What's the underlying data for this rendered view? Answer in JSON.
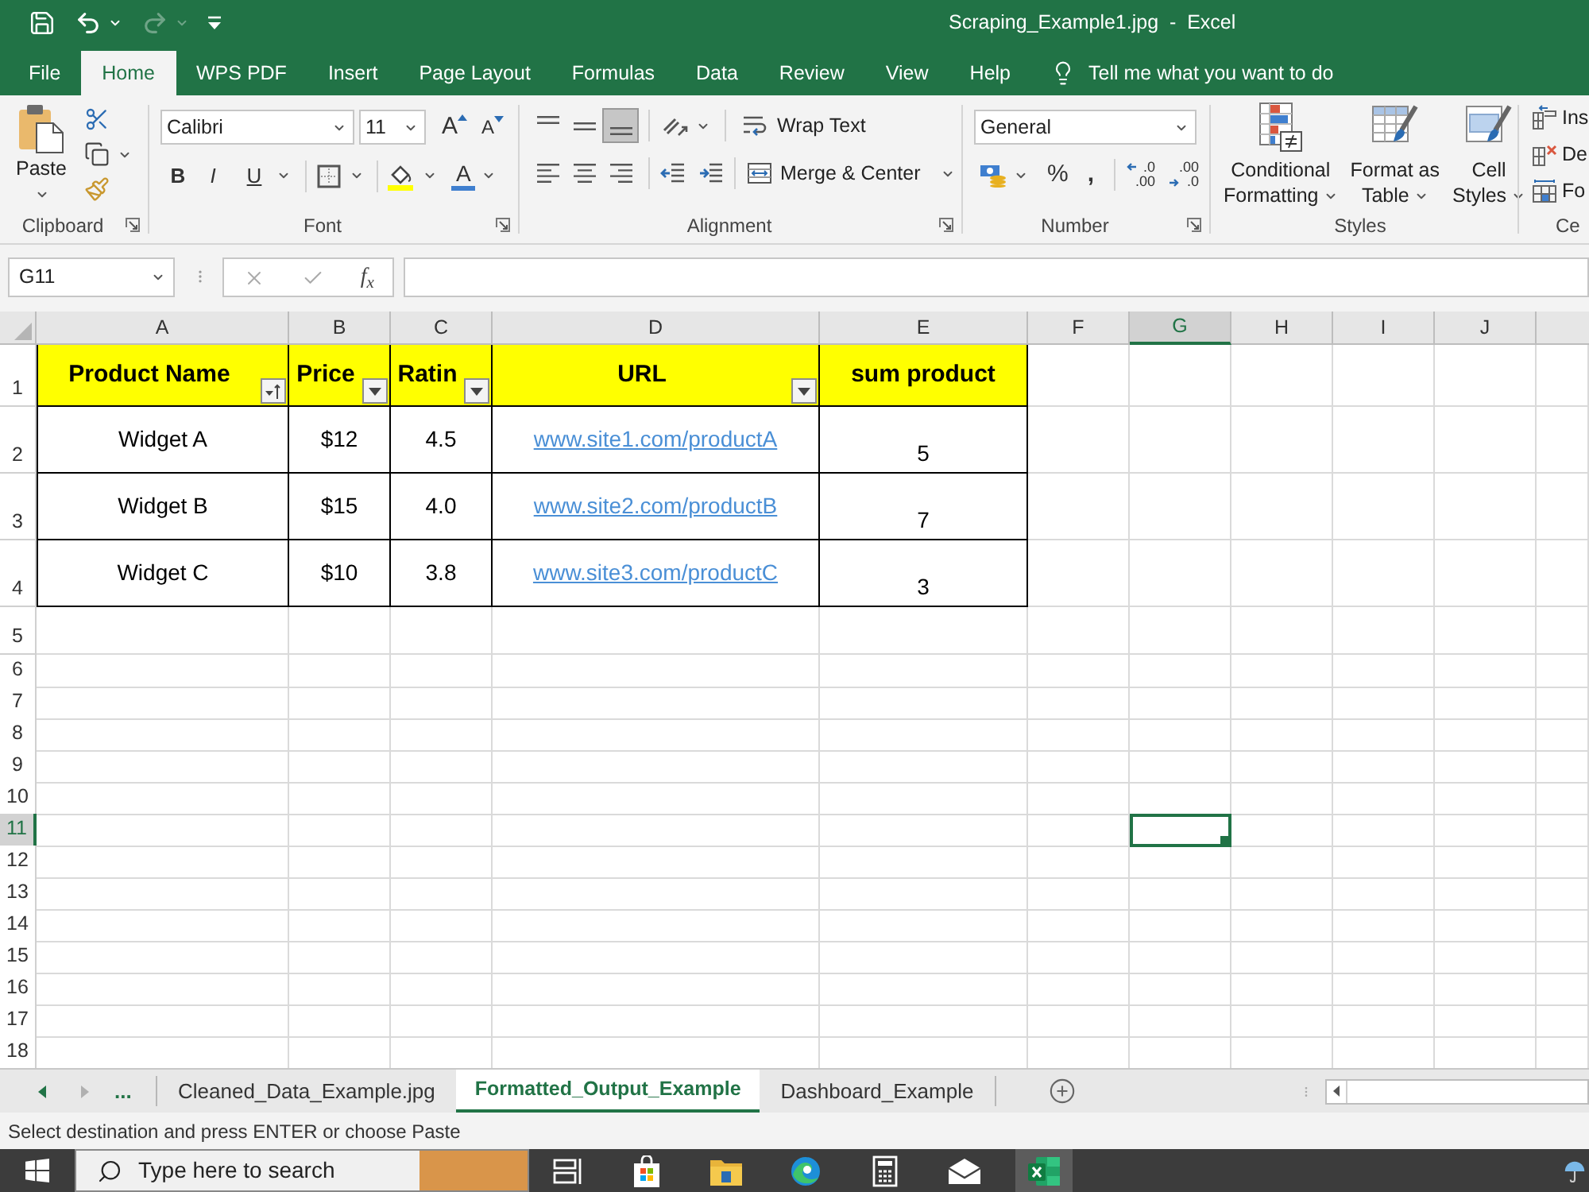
{
  "window": {
    "title": "Scraping_Example1.jpg  -  Excel"
  },
  "quick_access": [
    {
      "kind": "save",
      "disabled": false
    },
    {
      "kind": "undo",
      "disabled": false
    },
    {
      "kind": "redo",
      "disabled": true
    },
    {
      "kind": "customize",
      "disabled": false
    }
  ],
  "ribbon_tabs": [
    {
      "label": "File",
      "selected": false
    },
    {
      "label": "Home",
      "selected": true
    },
    {
      "label": "WPS PDF",
      "selected": false
    },
    {
      "label": "Insert",
      "selected": false
    },
    {
      "label": "Page Layout",
      "selected": false
    },
    {
      "label": "Formulas",
      "selected": false
    },
    {
      "label": "Data",
      "selected": false
    },
    {
      "label": "Review",
      "selected": false
    },
    {
      "label": "View",
      "selected": false
    },
    {
      "label": "Help",
      "selected": false
    }
  ],
  "tell_me": {
    "placeholder": "Tell me what you want to do"
  },
  "ribbon": {
    "clipboard": {
      "title": "Clipboard",
      "paste": "Paste"
    },
    "font": {
      "title": "Font",
      "font_name": "Calibri",
      "font_size": "11",
      "grow": "A",
      "shrink": "A",
      "bold": "B",
      "italic": "I",
      "underline": "U",
      "font_color": "A"
    },
    "alignment": {
      "title": "Alignment",
      "vertical": [
        {
          "kind": "top",
          "selected": false
        },
        {
          "kind": "middle",
          "selected": false
        },
        {
          "kind": "bottom",
          "selected": true
        }
      ],
      "horizontal": [
        {
          "kind": "left",
          "selected": false
        },
        {
          "kind": "center",
          "selected": false
        },
        {
          "kind": "right",
          "selected": false
        }
      ],
      "wrap_text": "Wrap Text",
      "merge": "Merge & Center"
    },
    "number": {
      "title": "Number",
      "format": "General",
      "percent": "%",
      "comma": ",",
      "increase_decimal": [
        ".0",
        ".00"
      ],
      "decrease_decimal": [
        ".00",
        ".0"
      ]
    },
    "styles": {
      "title": "Styles",
      "buttons": [
        {
          "kind": "conditional",
          "label": [
            "Conditional",
            "Formatting"
          ]
        },
        {
          "kind": "table",
          "label": [
            "Format as",
            "Table"
          ]
        },
        {
          "kind": "cell",
          "label": [
            "Cell",
            "Styles"
          ]
        }
      ]
    },
    "cells": {
      "title": "Ce",
      "buttons": [
        {
          "kind": "insert",
          "label": "Ins"
        },
        {
          "kind": "delete",
          "label": "De"
        },
        {
          "kind": "format",
          "label": "Fo"
        }
      ]
    }
  },
  "formula_bar": {
    "name_box": "G11",
    "function": "f$_{x}$"
  },
  "columns": [
    {
      "label": "A",
      "selected": false
    },
    {
      "label": "B",
      "selected": false
    },
    {
      "label": "C",
      "selected": false
    },
    {
      "label": "D",
      "selected": false
    },
    {
      "label": "E",
      "selected": false
    },
    {
      "label": "F",
      "selected": false
    },
    {
      "label": "G",
      "selected": true
    },
    {
      "label": "H",
      "selected": false
    },
    {
      "label": "I",
      "selected": false
    },
    {
      "label": "J",
      "selected": false
    }
  ],
  "rows": [
    {
      "label": "1",
      "selected": false
    },
    {
      "label": "2",
      "selected": false
    },
    {
      "label": "3",
      "selected": false
    },
    {
      "label": "4",
      "selected": false
    },
    {
      "label": "5",
      "selected": false
    },
    {
      "label": "6",
      "selected": false
    },
    {
      "label": "7",
      "selected": false
    },
    {
      "label": "8",
      "selected": false
    },
    {
      "label": "9",
      "selected": false
    },
    {
      "label": "10",
      "selected": false
    },
    {
      "label": "11",
      "selected": true
    },
    {
      "label": "12",
      "selected": false
    },
    {
      "label": "13",
      "selected": false
    },
    {
      "label": "14",
      "selected": false
    },
    {
      "label": "15",
      "selected": false
    },
    {
      "label": "16",
      "selected": false
    },
    {
      "label": "17",
      "selected": false
    },
    {
      "label": "18",
      "selected": false
    }
  ],
  "table": {
    "header": [
      {
        "text": "Product Name",
        "kind": "sorted"
      },
      {
        "text": "Price",
        "kind": "dropdown"
      },
      {
        "text": "Ratin",
        "kind": "dropdown"
      },
      {
        "text": "URL",
        "kind": "dropdown"
      },
      {
        "text": "sum product",
        "kind": "plain"
      }
    ],
    "rows": [
      {
        "product": "Widget A",
        "price": "$12",
        "rating": "4.5",
        "url": "www.site1.com/productA",
        "sum": "5"
      },
      {
        "product": "Widget B",
        "price": "$15",
        "rating": "4.0",
        "url": "www.site2.com/productB",
        "sum": "7"
      },
      {
        "product": "Widget C",
        "price": "$10",
        "rating": "3.8",
        "url": "www.site3.com/productC",
        "sum": "3"
      }
    ]
  },
  "sheet_nav": [
    {
      "kind": "previous",
      "disabled": false
    },
    {
      "kind": "next",
      "disabled": true
    }
  ],
  "more_sheets": "...",
  "sheet_tabs": [
    {
      "label": "Cleaned_Data_Example.jpg",
      "selected": false
    },
    {
      "label": "Formatted_Output_Example",
      "selected": true
    },
    {
      "label": "Dashboard_Example",
      "selected": false
    }
  ],
  "status_bar": "Select destination and press ENTER or choose Paste",
  "taskbar": {
    "search": {
      "placeholder": "Type here to search"
    },
    "apps": [
      {
        "kind": "task_view",
        "selected": false
      },
      {
        "kind": "store",
        "selected": false
      },
      {
        "kind": "explorer",
        "selected": false
      },
      {
        "kind": "browser",
        "selected": false
      },
      {
        "kind": "calculator",
        "selected": false
      },
      {
        "kind": "mail",
        "selected": false
      },
      {
        "kind": "spreadsheet",
        "selected": true
      }
    ]
  }
}
